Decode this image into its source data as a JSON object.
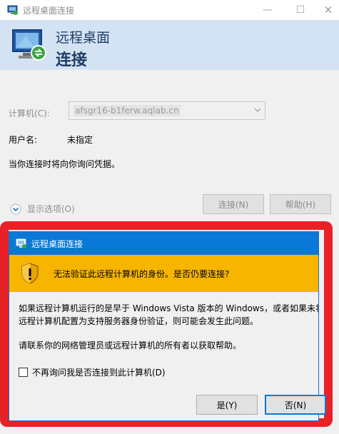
{
  "window": {
    "title": "远程桌面连接",
    "header_line1": "远程桌面",
    "header_line2": "连接",
    "controls": {
      "minimize": "—",
      "maximize": "☐",
      "close": "✕"
    }
  },
  "form": {
    "computer_label": "计算机(C):",
    "computer_value": "afsgr16-b1ferw.aqlab.cn",
    "user_label": "用户名:",
    "user_value": "未指定",
    "credential_note": "当你连接时将向你询问凭据。",
    "show_options": "显示选项(O)",
    "connect_button": "连接(N)",
    "help_button": "帮助(H)"
  },
  "dialog": {
    "title": "远程桌面连接",
    "warning": "无法验证此远程计算机的身份。是否仍要连接?",
    "message_line1": "如果远程计算机运行的是早于 Windows Vista 版本的 Windows，或者如果未将",
    "message_line2": "远程计算机配置为支持服务器身份验证，则可能会发生此问题。",
    "contact_note": "请联系你的网络管理员或远程计算机的所有者以获取帮助。",
    "checkbox_label": "不再询问我是否连接到此计算机(D)",
    "checkbox_checked": false,
    "yes_button": "是(Y)",
    "no_button": "否(N)"
  },
  "colors": {
    "header_bg": "#d4e3f3",
    "dialog_title_bg": "#0a78d7",
    "warning_band": "#f7b500",
    "highlight_frame": "#e82127"
  }
}
